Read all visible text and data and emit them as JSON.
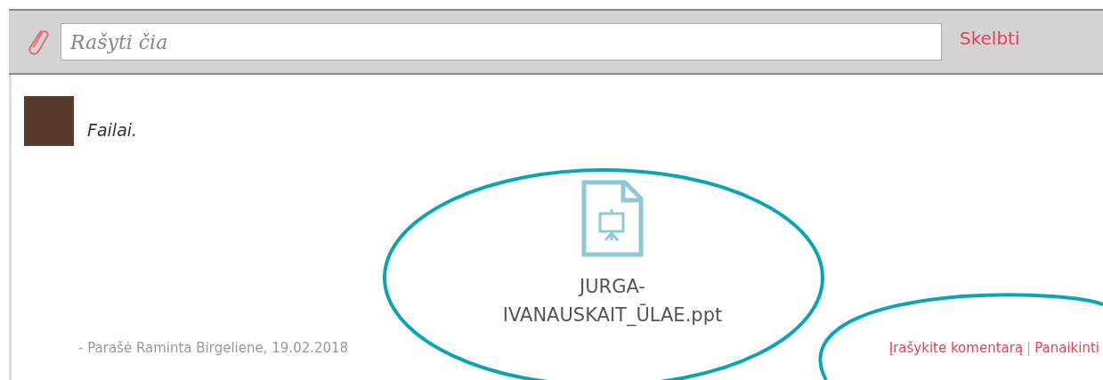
{
  "composer": {
    "placeholder": "Rašyti čia",
    "submit": "Skelbti"
  },
  "post": {
    "text": "Failai.",
    "attachment": {
      "filename_lines": [
        "JURGA-",
        "IVANAUSKAIT_ŪLAE.ppt"
      ]
    },
    "byline": "- Parašė Raminta Birgeliene, 19.02.2018",
    "actions": [
      {
        "label": "Įrašykite komentarą"
      },
      {
        "label": "Panaikinti"
      }
    ],
    "separator": "|"
  }
}
